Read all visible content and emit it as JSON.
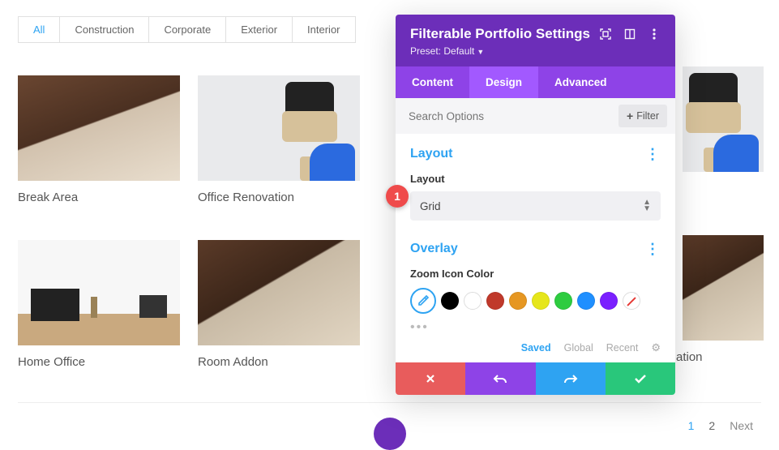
{
  "filters": {
    "items": [
      "All",
      "Construction",
      "Corporate",
      "Exterior",
      "Interior"
    ],
    "active_index": 0
  },
  "portfolio": {
    "items": [
      {
        "title": "Break Area"
      },
      {
        "title": "Office Renovation"
      },
      {
        "title": "Home Office"
      },
      {
        "title": "Room Addon"
      }
    ],
    "hidden_right_bottom_suffix": "ation"
  },
  "pagination": {
    "pages": [
      "1",
      "2"
    ],
    "next_label": "Next",
    "active_index": 0
  },
  "panel": {
    "title": "Filterable Portfolio Settings",
    "preset_label": "Preset: Default",
    "tabs": {
      "content": "Content",
      "design": "Design",
      "advanced": "Advanced",
      "active": "design"
    },
    "search_placeholder": "Search Options",
    "filter_button": "Filter",
    "sections": {
      "layout": {
        "title": "Layout",
        "field_label": "Layout",
        "select_value": "Grid"
      },
      "overlay": {
        "title": "Overlay",
        "field_label": "Zoom Icon Color",
        "swatches": [
          "#000000",
          "#ffffff",
          "#c0392b",
          "#e69722",
          "#e6e61a",
          "#2ecc40",
          "#1f8fff",
          "#7a1fff"
        ],
        "preset_tabs": {
          "saved": "Saved",
          "global": "Global",
          "recent": "Recent"
        }
      }
    }
  },
  "badge": {
    "one": "1"
  }
}
